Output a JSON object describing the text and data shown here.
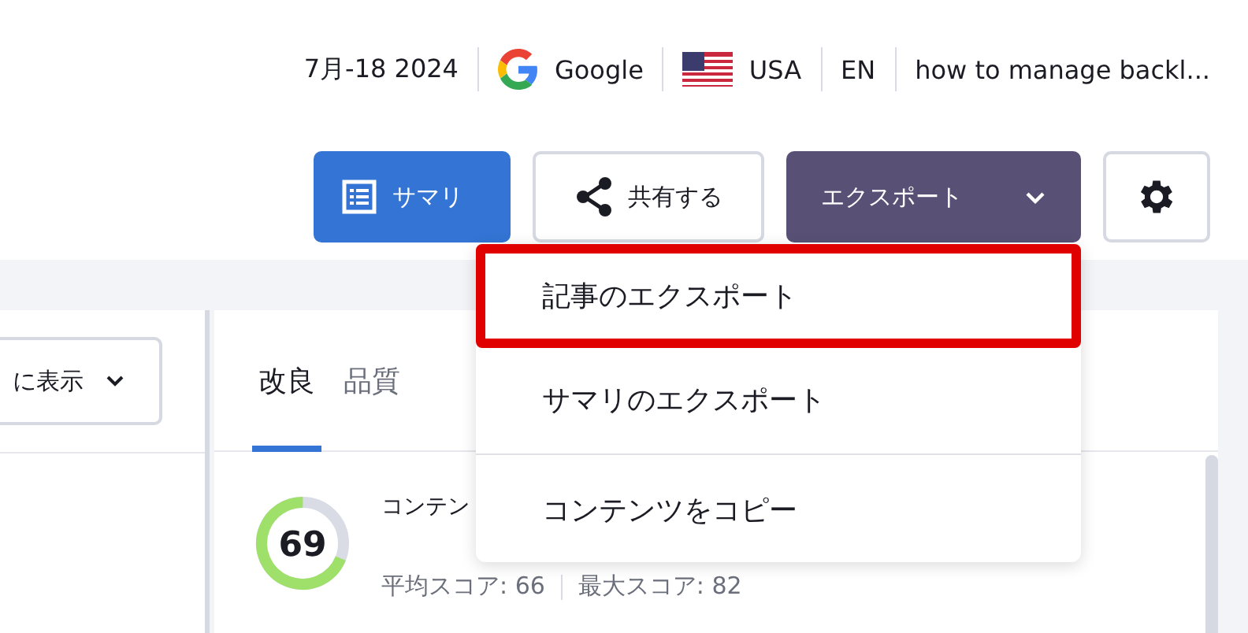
{
  "meta": [
    {
      "kind": "text",
      "text": "7月-18 2024"
    },
    {
      "kind": "google",
      "text": "Google"
    },
    {
      "kind": "flag",
      "text": "USA"
    },
    {
      "kind": "text",
      "text": "EN"
    },
    {
      "kind": "text",
      "text": "how to manage backl..."
    }
  ],
  "actions": [
    {
      "kind": "summary",
      "label": "サマリ"
    },
    {
      "kind": "share",
      "label": "共有する"
    },
    {
      "kind": "export",
      "label": "エクスポート"
    },
    {
      "kind": "settings"
    }
  ],
  "export_menu": [
    {
      "label": "記事のエクスポート",
      "highlighted": true,
      "divider_after": false
    },
    {
      "label": "サマリのエクスポート",
      "highlighted": false,
      "divider_after": true
    },
    {
      "label": "コンテンツをコピー",
      "highlighted": false,
      "divider_after": false
    }
  ],
  "left_panel": {
    "view_dropdown": "に表示"
  },
  "tabs": [
    {
      "label": "改良",
      "selected": true
    },
    {
      "label": "品質",
      "selected": false
    }
  ],
  "score": {
    "value": "69",
    "level": 0.69,
    "title": "コンテン",
    "average": "平均スコア: 66",
    "max": "最大スコア: 82"
  }
}
